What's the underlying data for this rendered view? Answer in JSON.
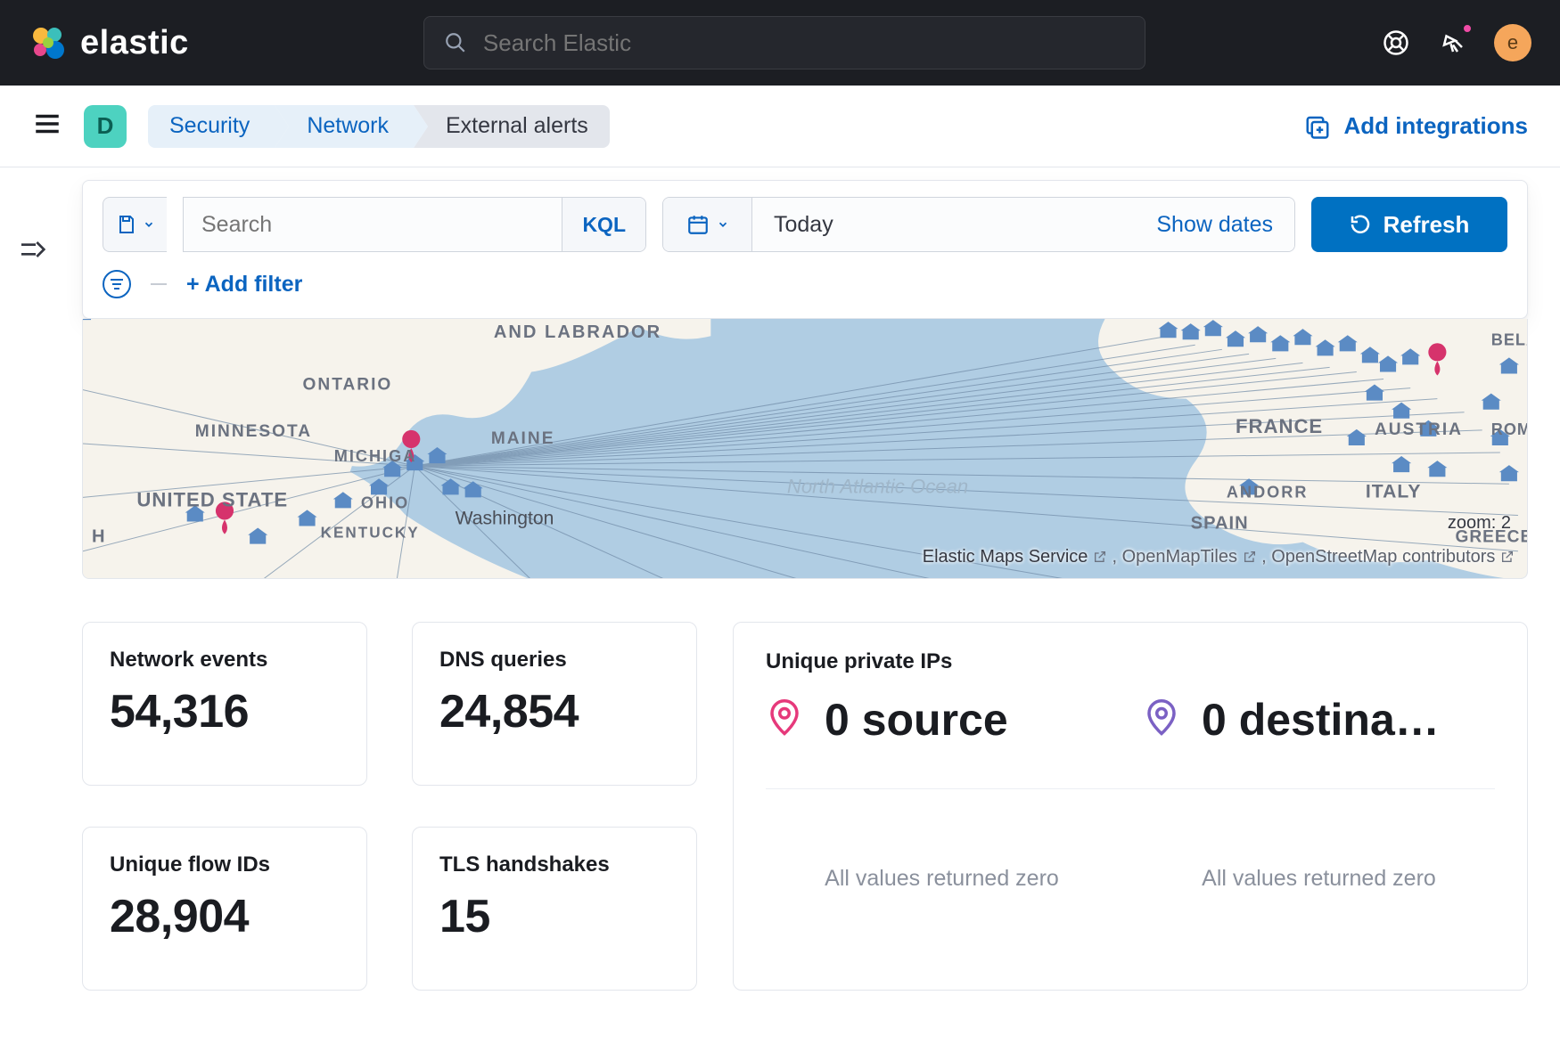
{
  "header": {
    "brand": "elastic",
    "global_search_placeholder": "Search Elastic",
    "avatar_initial": "e"
  },
  "subheader": {
    "space_initial": "D",
    "breadcrumbs": [
      "Security",
      "Network",
      "External alerts"
    ],
    "add_integrations": "Add integrations"
  },
  "filters": {
    "search_placeholder": "Search",
    "kql": "KQL",
    "date_value": "Today",
    "show_dates": "Show dates",
    "refresh": "Refresh",
    "add_filter": "+ Add filter"
  },
  "map": {
    "zoom_label": "zoom: 2",
    "attribution_prefix": "Elastic Maps Service",
    "attribution_mid": ", OpenMapTiles",
    "attribution_suffix": ", OpenStreetMap contributors",
    "labels": {
      "and_labrador": "AND LABRADOR",
      "ontario": "ONTARIO",
      "minnesota": "MINNESOTA",
      "michiga": "MICHIGA",
      "maine": "MAINE",
      "united_states": "UNITED STATE",
      "ohio": "OHIO",
      "kentucky": "KENTUCKY",
      "washington": "Washington",
      "h": "H",
      "north_atlantic_ocean": "North Atlantic Ocean",
      "france": "FRANCE",
      "austria": "AUSTRIA",
      "andorra": "ANDORR",
      "italy": "ITALY",
      "spain": "SPAIN",
      "greece": "GREECE",
      "romi": "ROMI",
      "bela": "BELA"
    }
  },
  "kpis": {
    "network_events": {
      "label": "Network events",
      "value": "54,316"
    },
    "dns_queries": {
      "label": "DNS queries",
      "value": "24,854"
    },
    "unique_flow": {
      "label": "Unique flow IDs",
      "value": "28,904"
    },
    "tls": {
      "label": "TLS handshakes",
      "value": "15"
    }
  },
  "unique_panel": {
    "title": "Unique private IPs",
    "source": "0 source",
    "destination": "0 destina…",
    "zero_msg": "All values returned zero"
  }
}
